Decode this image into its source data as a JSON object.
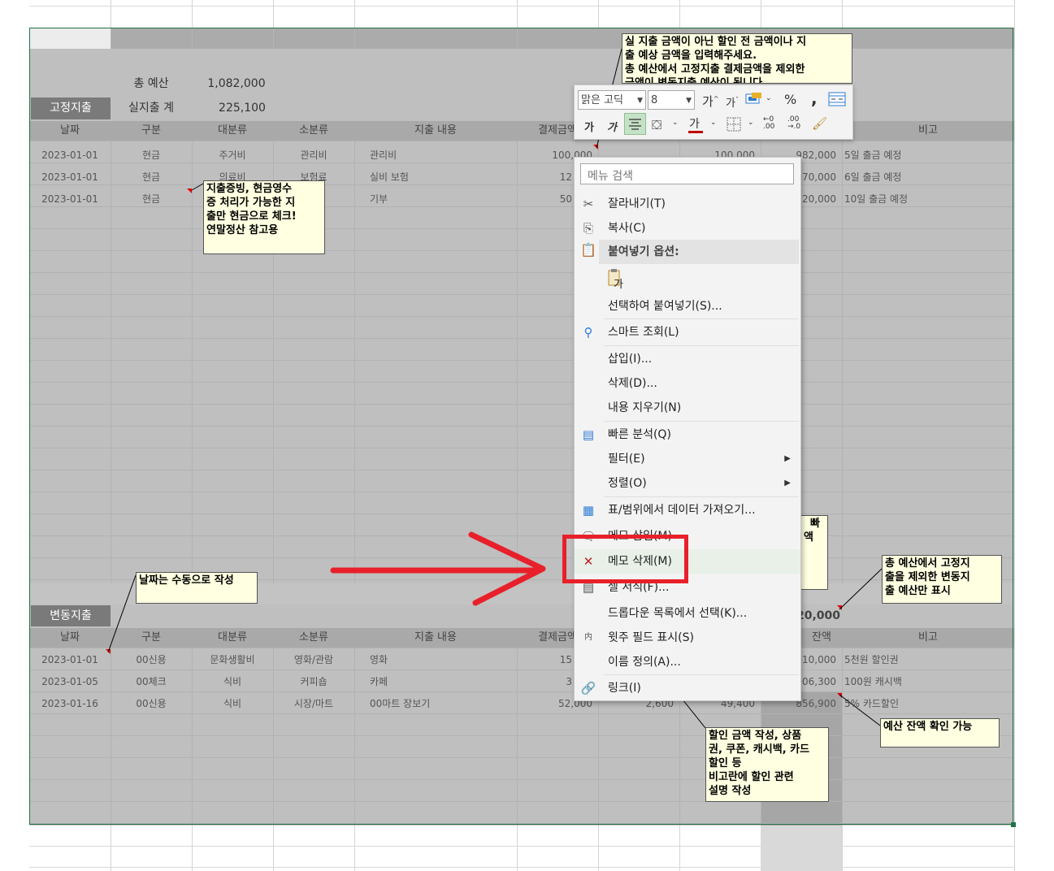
{
  "budget": {
    "total_label": "총 예산",
    "total_value": "1,082,000",
    "spent_label": "실지출 계",
    "spent_value": "225,100"
  },
  "fixed": {
    "title": "고정지출",
    "headers": [
      "날짜",
      "구분",
      "대분류",
      "소분류",
      "지출 내용",
      "결제금액",
      "",
      "",
      "비고"
    ],
    "rows": [
      {
        "date": "2023-01-01",
        "type": "현금",
        "cat": "주거비",
        "sub": "관리비",
        "desc": "관리비",
        "amount": "100,000",
        "g": "",
        "h": "100,000",
        "bal": "982,000",
        "note": "5일 출금 예정"
      },
      {
        "date": "2023-01-01",
        "type": "현금",
        "cat": "의료비",
        "sub": "보험료",
        "desc": "실비 보험",
        "amount": "12",
        "g": "",
        "h": "",
        "bal": "970,000",
        "note": "6일 출금 예정"
      },
      {
        "date": "2023-01-01",
        "type": "현금",
        "cat": "",
        "sub": "",
        "desc": "기부",
        "amount": "50",
        "g": "",
        "h": "",
        "bal": "920,000",
        "note": "10일 출금 예정"
      }
    ]
  },
  "variable": {
    "title": "변동지출",
    "remaining_partial": "20,000",
    "headers": [
      "날짜",
      "구분",
      "대분류",
      "소분류",
      "지출 내용",
      "결제금액",
      "",
      "잔액",
      "비고"
    ],
    "rows": [
      {
        "date": "2023-01-01",
        "type": "00신용",
        "cat": "문화생활비",
        "sub": "영화/관람",
        "desc": "영화",
        "amount": "15",
        "g": "",
        "h": "",
        "bal": "910,000",
        "note": "5천원 할인권"
      },
      {
        "date": "2023-01-05",
        "type": "00체크",
        "cat": "식비",
        "sub": "커피숍",
        "desc": "카페",
        "amount": "3",
        "g": "",
        "h": "",
        "bal": "906,300",
        "note": "100원 캐시백"
      },
      {
        "date": "2023-01-16",
        "type": "00신용",
        "cat": "식비",
        "sub": "시장/마트",
        "desc": "00마트 장보기",
        "amount": "52,000",
        "g": "2,600",
        "h": "49,400",
        "bal": "856,900",
        "note": "5% 카드할인"
      }
    ]
  },
  "comments": {
    "top_right": [
      "실 지출 금액이 아닌 할인 전 금액이나 지",
      "출 예상 금액을 입력해주세요.",
      "총 예산에서 고정지출 결제금액을 제외한",
      "금액이 변동지출 예산이 됩니다"
    ],
    "cash": [
      "지출증빙, 현금영수",
      "증 처리가 가능한 지",
      "출만 현금으로 체크!",
      "연말정산 참고용"
    ],
    "date": [
      "날짜는 수동으로 작성"
    ],
    "variable_budget": [
      "총 예산에서 고정지",
      "출을 제외한 변동지",
      "출 예산만 표시"
    ],
    "balance": [
      "예산 잔액 확인 가능"
    ],
    "discount": [
      "할인 금액 작성, 상품",
      "권, 쿠폰, 캐시백, 카드",
      "할인 등",
      "비고란에 할인 관련",
      "설명 작성"
    ],
    "hidden_partial": [
      "빠",
      "액"
    ]
  },
  "mini_toolbar": {
    "font_name": "맑은 고딕",
    "font_size": "8",
    "grow_font": "가",
    "shrink_font": "가",
    "percent": "%",
    "comma": ",",
    "bold": "가",
    "italic": "가",
    "font_color_glyph": "가",
    "colors": {
      "font_color": "#c00000",
      "fill_color": "#ffff00"
    }
  },
  "context_menu": {
    "search_placeholder": "메뉴 검색",
    "items": [
      {
        "label": "잘라내기(T)",
        "icon": "scissors-icon"
      },
      {
        "label": "복사(C)",
        "icon": "copy-icon"
      },
      {
        "label": "붙여넣기 옵션:",
        "icon": "paste-icon"
      },
      {
        "label": "가",
        "icon": "paste-keep-text-icon"
      },
      {
        "label": "선택하여 붙여넣기(S)...",
        "icon": ""
      },
      {
        "label": "스마트 조회(L)",
        "icon": "smart-lookup-icon"
      },
      {
        "label": "삽입(I)...",
        "icon": ""
      },
      {
        "label": "삭제(D)...",
        "icon": ""
      },
      {
        "label": "내용 지우기(N)",
        "icon": ""
      },
      {
        "label": "빠른 분석(Q)",
        "icon": "quick-analysis-icon"
      },
      {
        "label": "필터(E)",
        "icon": ""
      },
      {
        "label": "정렬(O)",
        "icon": ""
      },
      {
        "label": "표/범위에서 데이터 가져오기...",
        "icon": "table-icon"
      },
      {
        "label": "메모 삽입(M)",
        "icon": "new-comment-icon"
      },
      {
        "label": "메모 삭제(M)",
        "icon": "delete-comment-icon"
      },
      {
        "label": "셀 서식(F)...",
        "icon": "format-cells-icon"
      },
      {
        "label": "드롭다운 목록에서 선택(K)...",
        "icon": ""
      },
      {
        "label": "윗주 필드 표시(S)",
        "icon": "phonetic-icon"
      },
      {
        "label": "이름 정의(A)...",
        "icon": ""
      },
      {
        "label": "링크(I)",
        "icon": "link-icon"
      }
    ]
  }
}
